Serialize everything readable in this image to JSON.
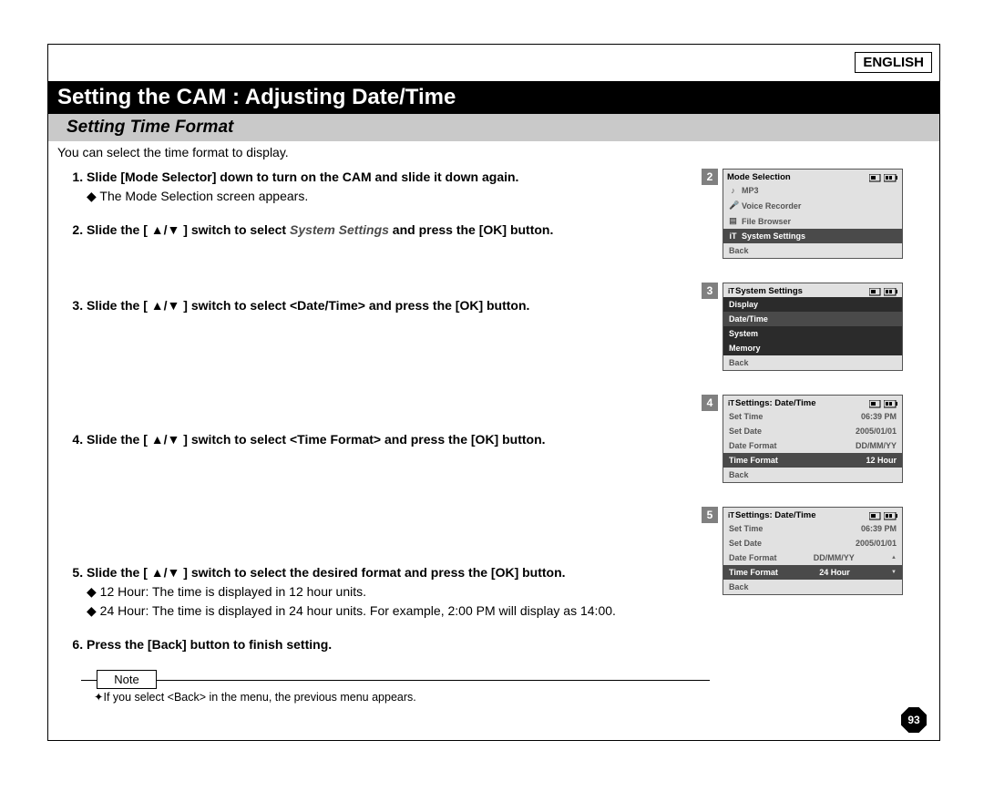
{
  "language": "ENGLISH",
  "title": "Setting the CAM : Adjusting Date/Time",
  "subtitle": "Setting Time Format",
  "intro": "You can select the time format to display.",
  "steps": {
    "s1": {
      "main": "Slide [Mode Selector] down to turn on the CAM and slide it down again.",
      "detail": "◆ The Mode Selection screen appears."
    },
    "s2": {
      "prefix": "Slide the [ ▲/▼ ] switch to select ",
      "em": "System Settings",
      "suffix": " and press the [OK] button."
    },
    "s3": {
      "main": "Slide the [ ▲/▼ ] switch to select <Date/Time> and press the [OK] button."
    },
    "s4": {
      "main": "Slide the [ ▲/▼ ] switch to select <Time Format> and press the [OK] button."
    },
    "s5": {
      "main": "Slide the [ ▲/▼ ] switch to select the desired format and press the [OK] button.",
      "d1": "◆ 12 Hour: The time is displayed in 12 hour units.",
      "d2": "◆ 24 Hour: The time is displayed in 24 hour units. For example, 2:00 PM will display as 14:00."
    },
    "s6": {
      "main": "Press the [Back] button to finish setting."
    }
  },
  "note": {
    "label": "Note",
    "text": "If you select <Back> in the menu, the previous menu appears."
  },
  "screens": {
    "n2": "2",
    "n3": "3",
    "n4": "4",
    "n5": "5",
    "modeSelection": {
      "title": "Mode Selection",
      "items": [
        "MP3",
        "Voice Recorder",
        "File Browser",
        "System Settings",
        "Back"
      ]
    },
    "systemSettings": {
      "title": "System Settings",
      "items": [
        "Display",
        "Date/Time",
        "System",
        "Memory",
        "Back"
      ]
    },
    "dateTime4": {
      "title": "Settings: Date/Time",
      "rows": [
        {
          "k": "Set Time",
          "v": "06:39 PM"
        },
        {
          "k": "Set Date",
          "v": "2005/01/01"
        },
        {
          "k": "Date Format",
          "v": "DD/MM/YY"
        },
        {
          "k": "Time Format",
          "v": "12 Hour"
        },
        {
          "k": "Back",
          "v": ""
        }
      ]
    },
    "dateTime5": {
      "title": "Settings: Date/Time",
      "rows": [
        {
          "k": "Set Time",
          "v": "06:39 PM"
        },
        {
          "k": "Set Date",
          "v": "2005/01/01"
        },
        {
          "k": "Date Format",
          "v": "DD/MM/YY"
        },
        {
          "k": "Time Format",
          "v": "24 Hour"
        },
        {
          "k": "Back",
          "v": ""
        }
      ]
    }
  },
  "pageNumber": "93"
}
